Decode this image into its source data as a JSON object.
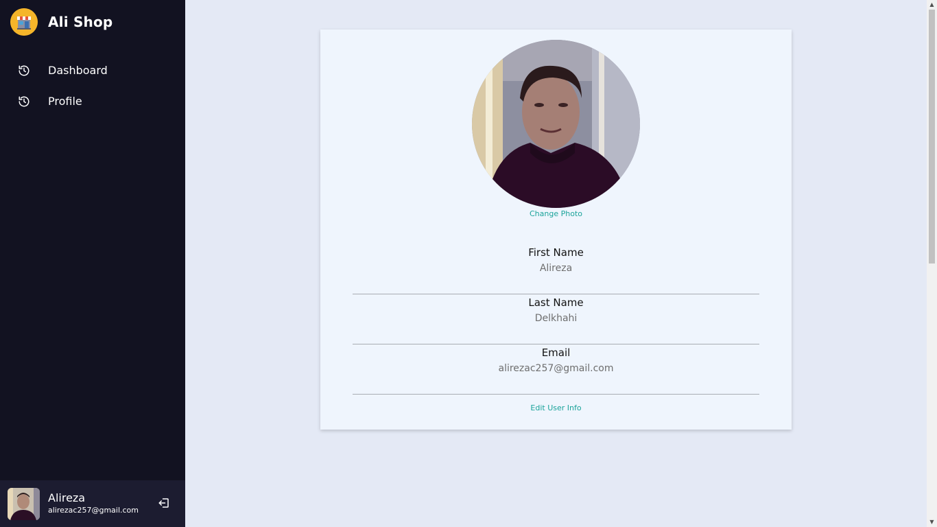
{
  "brand": {
    "title": "Ali Shop",
    "logo_icon": "shop-icon",
    "logo_color": "#f5b52a"
  },
  "sidebar": {
    "items": [
      {
        "label": "Dashboard",
        "icon": "history-icon"
      },
      {
        "label": "Profile",
        "icon": "history-icon"
      }
    ],
    "background": "#121221"
  },
  "user": {
    "name": "Alireza",
    "email": "alirezac257@gmail.com",
    "logout_icon": "logout-icon"
  },
  "profile": {
    "change_photo_label": "Change Photo",
    "fields": [
      {
        "label": "First Name",
        "value": "Alireza"
      },
      {
        "label": "Last Name",
        "value": "Delkhahi"
      },
      {
        "label": "Email",
        "value": "alirezac257@gmail.com"
      }
    ],
    "edit_label": "Edit User Info",
    "accent": "#1aa39a"
  }
}
